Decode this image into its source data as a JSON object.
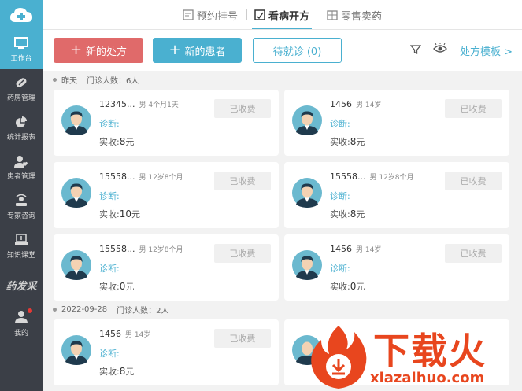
{
  "sidebar": {
    "items": [
      {
        "label": "工作台",
        "icon": "monitor-icon"
      },
      {
        "label": "药房管理",
        "icon": "pill-icon"
      },
      {
        "label": "统计报表",
        "icon": "pie-chart-icon"
      },
      {
        "label": "患者管理",
        "icon": "user-heart-icon"
      },
      {
        "label": "专家咨询",
        "icon": "consult-icon"
      },
      {
        "label": "知识课堂",
        "icon": "classroom-icon"
      }
    ],
    "brand": "药发采",
    "me": "我的"
  },
  "tabs": [
    {
      "label": "预约挂号",
      "icon": "calendar-icon"
    },
    {
      "label": "看病开方",
      "icon": "prescription-icon"
    },
    {
      "label": "零售卖药",
      "icon": "store-icon"
    }
  ],
  "actions": {
    "new_prescription": "新的处方",
    "new_patient": "新的患者",
    "waiting": "待就诊 (0)",
    "template": "处方模板 >"
  },
  "labels": {
    "diagnosis": "诊断:",
    "paid_prefix": "实收:",
    "yuan": "元"
  },
  "groups": [
    {
      "date": "昨天",
      "count": "门诊人数：6人"
    },
    {
      "date": "2022-09-28",
      "count": "门诊人数：2人"
    }
  ],
  "cards": [
    {
      "name": "12345...",
      "meta": "男  4个月1天",
      "amount": "8",
      "status": "已收费"
    },
    {
      "name": "1456",
      "meta": "男  14岁",
      "amount": "8",
      "status": "已收费"
    },
    {
      "name": "15558...",
      "meta": "男  12岁8个月",
      "amount": "10",
      "status": "已收费"
    },
    {
      "name": "15558...",
      "meta": "男  12岁8个月",
      "amount": "8",
      "status": "已收费"
    },
    {
      "name": "15558...",
      "meta": "男  12岁8个月",
      "amount": "0",
      "status": "已收费"
    },
    {
      "name": "1456",
      "meta": "男  14岁",
      "amount": "0",
      "status": "已收费"
    },
    {
      "name": "1456",
      "meta": "男  14岁",
      "amount": "8",
      "status": "已收费"
    }
  ],
  "watermark": {
    "text": "下载火",
    "url": "xiazaihuo.com"
  },
  "colors": {
    "accent": "#4ab0d0",
    "danger": "#e06a6a",
    "sidebar": "#3b3f47",
    "watermark": "#e8461e"
  }
}
